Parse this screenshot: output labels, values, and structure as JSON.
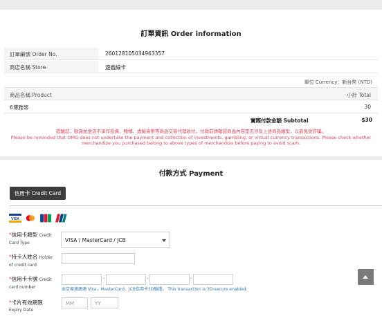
{
  "order": {
    "title": "訂單資訊 Order information",
    "order_no_label": "訂單編號 Order No.",
    "order_no_value": "260128105034963357",
    "store_label": "商店名稱 Store",
    "store_value": "遊戲線卡",
    "currency_unit": "單位 Currency：新台幣 (NTD)",
    "product_label": "商品名稱 Product",
    "total_label": "小計 Total",
    "product_name": "6博雅幣",
    "product_total": "30",
    "subtotal_label": "實際付款金額 Subtotal",
    "subtotal_value": "$30",
    "warning_line1": "提醒您，歐買尬金流不承作投資、賭博、虛擬貨幣等商品交易代理收付，付款前請確認商品內容是否涉及上述商品類型，以避免受詐騙。",
    "warning_line2": "Please be reminded that OMG does not undertake the payment and collection of investments, gambling, or virtual currency transactions. Please check whether",
    "warning_line3": "merchandize you purchased belong to above types of merchandize before paying to avoid scam."
  },
  "payment": {
    "title": "付款方式 Payment",
    "tab_credit_card": "信用卡 Credit Card",
    "card_icons": [
      "visa-icon",
      "mastercard-icon",
      "jcb-icon",
      "unionpay-icon"
    ],
    "card_type_label": "信用卡類型",
    "card_type_label_en_1": "Credit",
    "card_type_label_en_2": "Card Type",
    "card_type_value": "VISA / MasterCard / JCB",
    "holder_label": "持卡人姓名",
    "holder_label_en_1": "Holder",
    "holder_label_en_2": "of credit card",
    "card_no_label": "信用卡卡號",
    "card_no_label_en_1": "Credit",
    "card_no_label_en_2": "card number",
    "card_note": "本交易適適適 Visa、MasterCard、JCB信用卡3D驗證。 This transaction is 3D-secure enabled.",
    "expiry_label": "卡片有效期限",
    "expiry_label_en": "Expiry Date",
    "mm_placeholder": "MM",
    "yy_placeholder": "YY",
    "required_mark": "*",
    "dash": "-"
  },
  "colors": {
    "warning": "#e8435b",
    "tab_bg": "#3d3d3d",
    "note": "#2f7bbf"
  }
}
